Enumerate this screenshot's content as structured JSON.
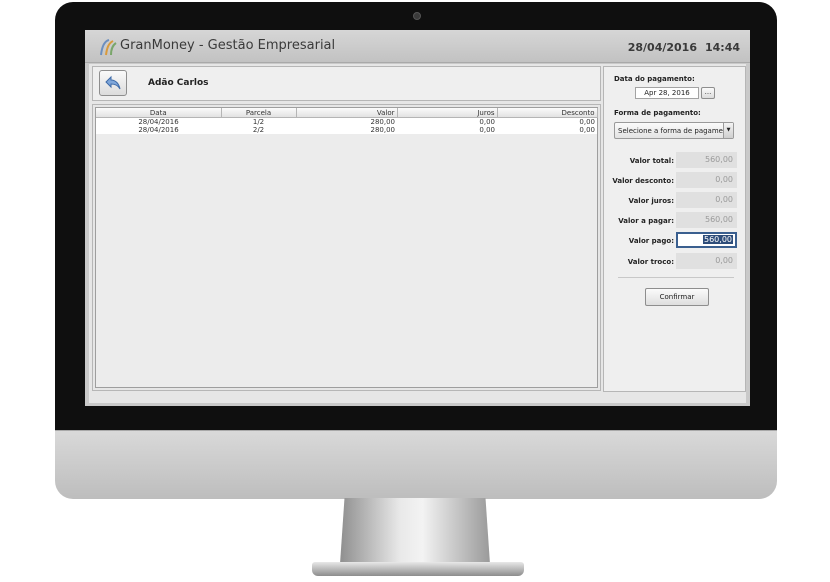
{
  "app": {
    "title": "GranMoney - Gestão Empresarial",
    "date": "28/04/2016",
    "time": "14:44"
  },
  "header": {
    "client_name": "Adão Carlos"
  },
  "table": {
    "columns": [
      "Data",
      "Parcela",
      "Valor",
      "Juros",
      "Desconto"
    ],
    "rows": [
      [
        "28/04/2016",
        "1/2",
        "280,00",
        "0,00",
        "0,00"
      ],
      [
        "28/04/2016",
        "2/2",
        "280,00",
        "0,00",
        "0,00"
      ]
    ]
  },
  "payment": {
    "date_label": "Data do pagamento:",
    "date_value": "Apr 28, 2016",
    "date_button": "...",
    "method_label": "Forma de pagamento:",
    "method_value": "Selecione a forma de pagame...",
    "total_label": "Valor total:",
    "total_value": "560,00",
    "discount_label": "Valor desconto:",
    "discount_value": "0,00",
    "interest_label": "Valor juros:",
    "interest_value": "0,00",
    "topay_label": "Valor a pagar:",
    "topay_value": "560,00",
    "paid_label": "Valor pago:",
    "paid_value": "560,00",
    "change_label": "Valor troco:",
    "change_value": "0,00",
    "confirm_label": "Confirmar"
  },
  "colors": {
    "titlebar": "#c9c9c9",
    "workarea": "#e6e6e6",
    "selection": "#2e4d7a"
  }
}
